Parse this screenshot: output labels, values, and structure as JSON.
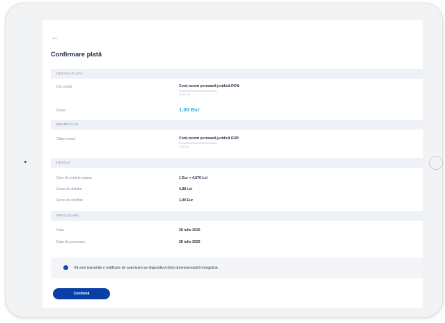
{
  "header": {
    "back_icon": "arrow-left-icon",
    "title": "Confirmare plată"
  },
  "sections": {
    "payment_details": "DETALII PLATĂ",
    "beneficiary": "BENEFICIAR",
    "details": "DETALII",
    "processing": "PROCESARE"
  },
  "payment": {
    "from_label": "Din contul",
    "from_account": "Conț curent persoană juridică RON",
    "from_iban": "RO00RNCB0000000000000000",
    "from_balance": "10,00 Lei",
    "amount_label": "Suma",
    "amount_value": "1,00 Eur"
  },
  "beneficiary": {
    "to_label": "Către contul",
    "to_account": "Conț curent persoană juridică EUR",
    "to_iban": "RO00RNCB0000000000000000",
    "to_balance": "3,50 Eur"
  },
  "details": {
    "exchange_label": "Curs de schimb valutar",
    "exchange_value": "1 Eur = 4,870 Lei",
    "debit_label": "Suma de debitat",
    "debit_value": "4,88 Lei",
    "credit_label": "Suma de creditat",
    "credit_value": "1,00 Eur"
  },
  "processing": {
    "date_label": "Data",
    "date_value": "28 iulie 2020",
    "processing_date_label": "Data de procesare",
    "processing_date_value": "28 iulie 2020"
  },
  "notice": {
    "icon": "info-dot-icon",
    "text": "Vă vom transmite o notificare de autorizare pe dispozitivul (ele) dumneavoastră înregistrat."
  },
  "actions": {
    "confirm_label": "Confirmă"
  },
  "colors": {
    "primary": "#0a3fa8",
    "amount_accent": "#2aa7e0",
    "section_bg": "#eef1f6"
  }
}
